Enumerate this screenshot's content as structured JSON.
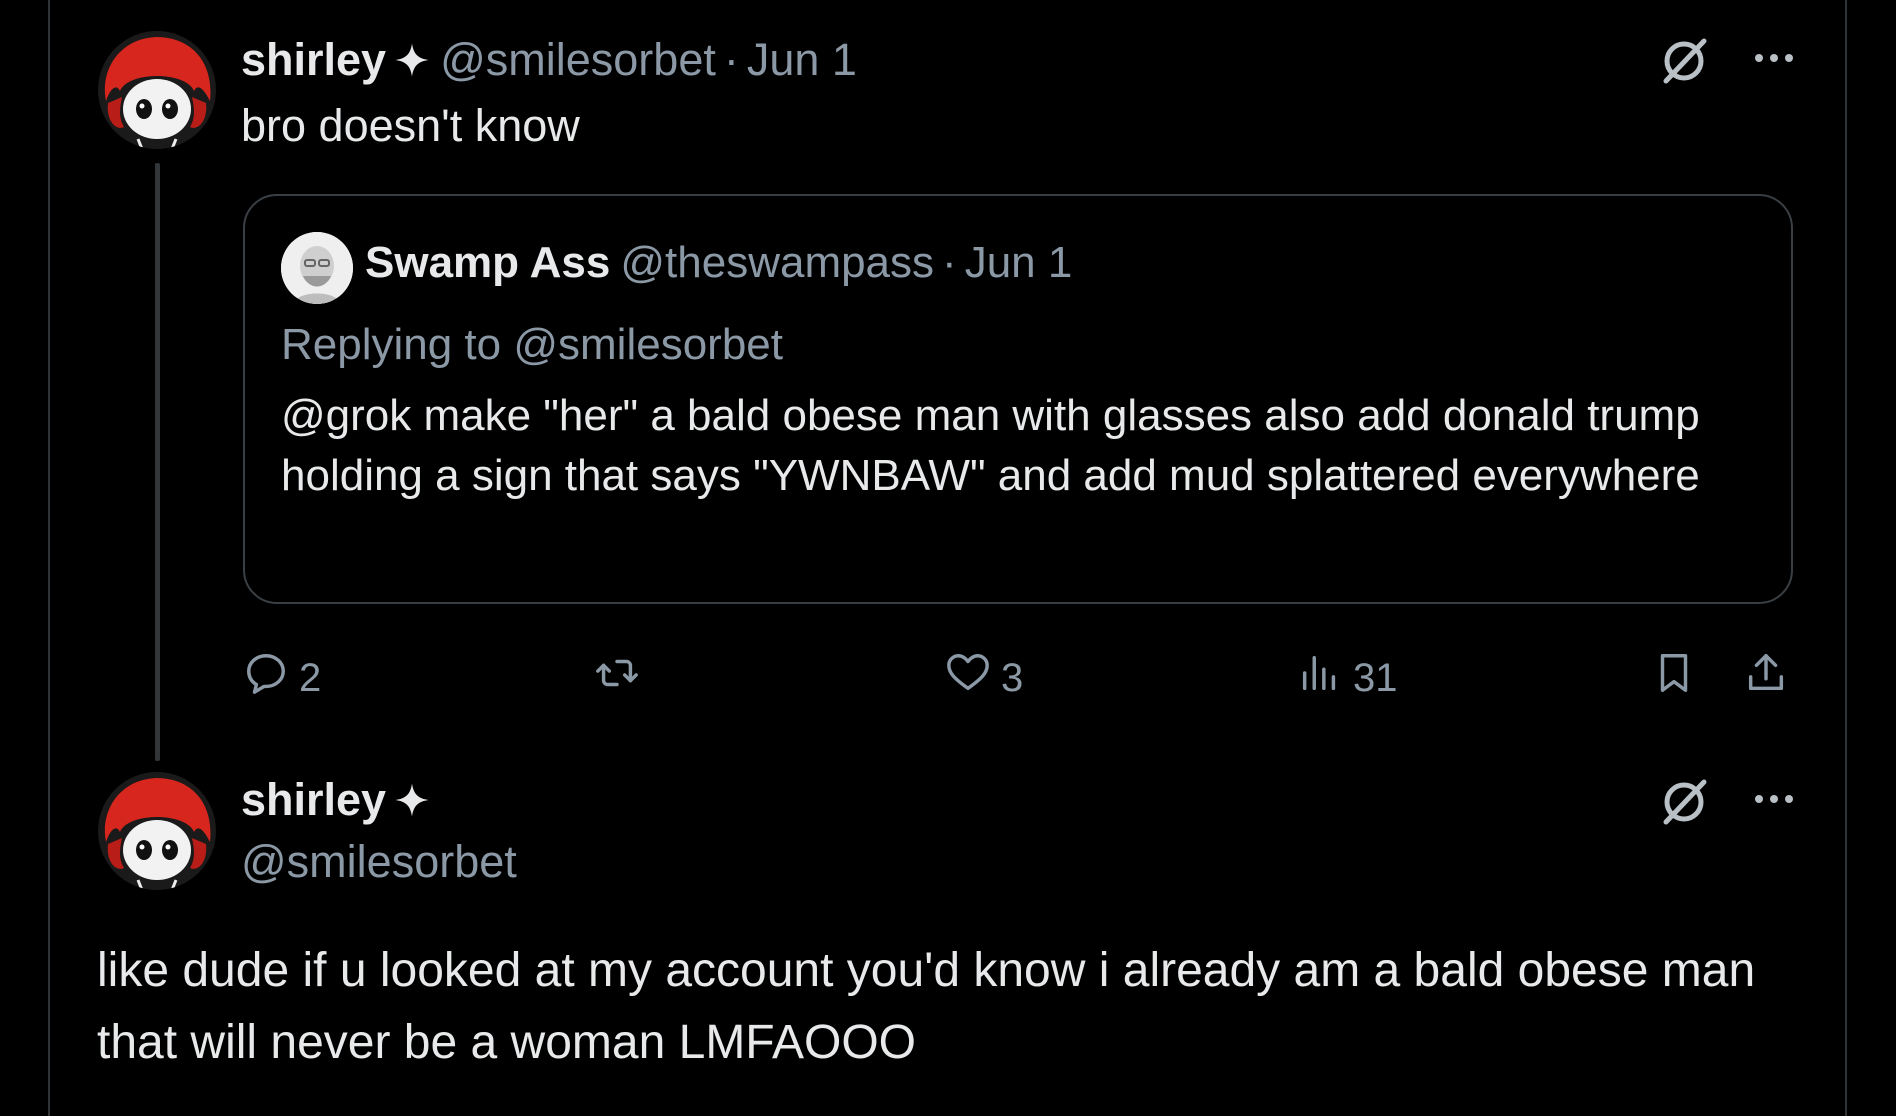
{
  "parent_tweet": {
    "author_name": "shirley",
    "handle": "@smilesorbet",
    "separator": "·",
    "date": "Jun 1",
    "text": "bro doesn't know",
    "quoted_tweet": {
      "author_name": "Swamp Ass",
      "handle": "@theswampass",
      "separator": "·",
      "date": "Jun 1",
      "replying_to": "Replying to @smilesorbet",
      "text": "@grok make \"her\" a bald obese man with glasses also add donald trump holding a sign that says \"YWNBAW\" and add mud splattered everywhere"
    },
    "actions": {
      "reply_count": "2",
      "retweet_count": "",
      "like_count": "3",
      "views_count": "31"
    }
  },
  "main_tweet": {
    "author_name": "shirley",
    "handle": "@smilesorbet",
    "text": "like dude if u looked at my account you'd know i already am a bald obese man that will never be a woman LMFAOOO"
  },
  "colors": {
    "background": "#000000",
    "primary_text": "#e7e9ea",
    "secondary_text": "#8b98a5",
    "border": "#2f3336",
    "avatar_hair": "#d7261e"
  },
  "icons": [
    "verified-sparkle-icon",
    "grok-icon",
    "more-icon",
    "reply-icon",
    "retweet-icon",
    "like-icon",
    "views-icon",
    "bookmark-icon",
    "share-icon"
  ]
}
